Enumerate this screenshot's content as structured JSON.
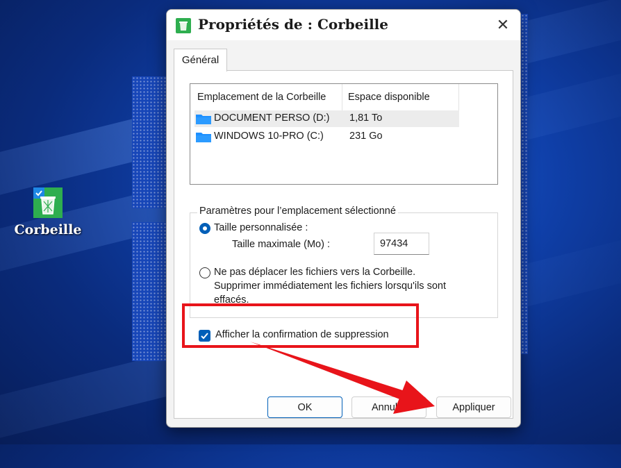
{
  "desktop": {
    "icon_label": "Corbeille",
    "icon_name": "recycle-bin-icon"
  },
  "dialog": {
    "title": "Propriétés de : Corbeille",
    "close_glyph": "✕",
    "tab": "Général",
    "list": {
      "headers": [
        "Emplacement de la Corbeille",
        "Espace disponible"
      ],
      "rows": [
        {
          "name": "DOCUMENT PERSO (D:)",
          "space": "1,81 To",
          "selected": true
        },
        {
          "name": "WINDOWS 10-PRO (C:)",
          "space": "231 Go",
          "selected": false
        }
      ]
    },
    "group": {
      "title": "Paramètres pour l’emplacement sélectionné",
      "custom_size_label": "Taille personnalisée :",
      "max_size_label": "Taille maximale (Mo) :",
      "max_size_value": "97434",
      "no_move_line1": "Ne pas déplacer les fichiers vers la Corbeille.",
      "no_move_line2": "Supprimer immédiatement les fichiers lorsqu'ils sont",
      "no_move_line3": "effacés.",
      "selected_option": "custom_size"
    },
    "confirm_label": "Afficher la confirmation de suppression",
    "confirm_checked": true,
    "buttons": {
      "ok": "OK",
      "cancel": "Annuler",
      "apply": "Appliquer"
    }
  },
  "colors": {
    "accent": "#005fb8",
    "annotation_red": "#e8141a",
    "folder": "#1e90ff",
    "recycle_green": "#2eae4f"
  }
}
